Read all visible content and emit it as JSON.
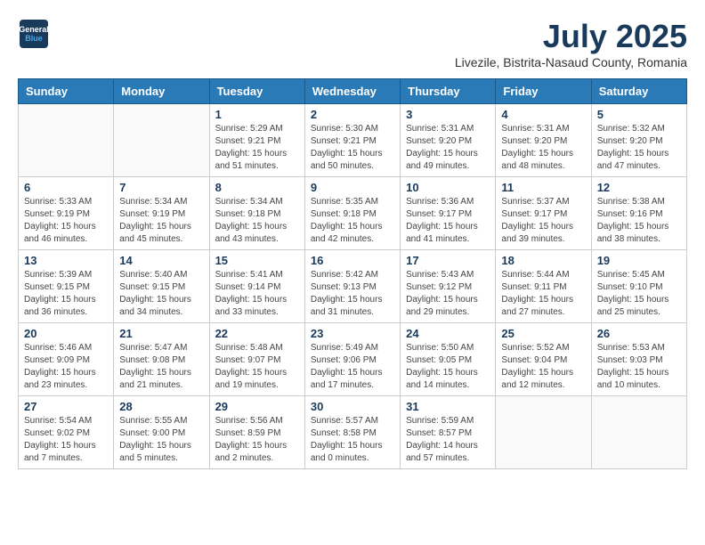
{
  "header": {
    "logo_line1": "General",
    "logo_line2": "Blue",
    "month_title": "July 2025",
    "subtitle": "Livezile, Bistrita-Nasaud County, Romania"
  },
  "weekdays": [
    "Sunday",
    "Monday",
    "Tuesday",
    "Wednesday",
    "Thursday",
    "Friday",
    "Saturday"
  ],
  "weeks": [
    [
      {
        "day": "",
        "info": ""
      },
      {
        "day": "",
        "info": ""
      },
      {
        "day": "1",
        "info": "Sunrise: 5:29 AM\nSunset: 9:21 PM\nDaylight: 15 hours and 51 minutes."
      },
      {
        "day": "2",
        "info": "Sunrise: 5:30 AM\nSunset: 9:21 PM\nDaylight: 15 hours and 50 minutes."
      },
      {
        "day": "3",
        "info": "Sunrise: 5:31 AM\nSunset: 9:20 PM\nDaylight: 15 hours and 49 minutes."
      },
      {
        "day": "4",
        "info": "Sunrise: 5:31 AM\nSunset: 9:20 PM\nDaylight: 15 hours and 48 minutes."
      },
      {
        "day": "5",
        "info": "Sunrise: 5:32 AM\nSunset: 9:20 PM\nDaylight: 15 hours and 47 minutes."
      }
    ],
    [
      {
        "day": "6",
        "info": "Sunrise: 5:33 AM\nSunset: 9:19 PM\nDaylight: 15 hours and 46 minutes."
      },
      {
        "day": "7",
        "info": "Sunrise: 5:34 AM\nSunset: 9:19 PM\nDaylight: 15 hours and 45 minutes."
      },
      {
        "day": "8",
        "info": "Sunrise: 5:34 AM\nSunset: 9:18 PM\nDaylight: 15 hours and 43 minutes."
      },
      {
        "day": "9",
        "info": "Sunrise: 5:35 AM\nSunset: 9:18 PM\nDaylight: 15 hours and 42 minutes."
      },
      {
        "day": "10",
        "info": "Sunrise: 5:36 AM\nSunset: 9:17 PM\nDaylight: 15 hours and 41 minutes."
      },
      {
        "day": "11",
        "info": "Sunrise: 5:37 AM\nSunset: 9:17 PM\nDaylight: 15 hours and 39 minutes."
      },
      {
        "day": "12",
        "info": "Sunrise: 5:38 AM\nSunset: 9:16 PM\nDaylight: 15 hours and 38 minutes."
      }
    ],
    [
      {
        "day": "13",
        "info": "Sunrise: 5:39 AM\nSunset: 9:15 PM\nDaylight: 15 hours and 36 minutes."
      },
      {
        "day": "14",
        "info": "Sunrise: 5:40 AM\nSunset: 9:15 PM\nDaylight: 15 hours and 34 minutes."
      },
      {
        "day": "15",
        "info": "Sunrise: 5:41 AM\nSunset: 9:14 PM\nDaylight: 15 hours and 33 minutes."
      },
      {
        "day": "16",
        "info": "Sunrise: 5:42 AM\nSunset: 9:13 PM\nDaylight: 15 hours and 31 minutes."
      },
      {
        "day": "17",
        "info": "Sunrise: 5:43 AM\nSunset: 9:12 PM\nDaylight: 15 hours and 29 minutes."
      },
      {
        "day": "18",
        "info": "Sunrise: 5:44 AM\nSunset: 9:11 PM\nDaylight: 15 hours and 27 minutes."
      },
      {
        "day": "19",
        "info": "Sunrise: 5:45 AM\nSunset: 9:10 PM\nDaylight: 15 hours and 25 minutes."
      }
    ],
    [
      {
        "day": "20",
        "info": "Sunrise: 5:46 AM\nSunset: 9:09 PM\nDaylight: 15 hours and 23 minutes."
      },
      {
        "day": "21",
        "info": "Sunrise: 5:47 AM\nSunset: 9:08 PM\nDaylight: 15 hours and 21 minutes."
      },
      {
        "day": "22",
        "info": "Sunrise: 5:48 AM\nSunset: 9:07 PM\nDaylight: 15 hours and 19 minutes."
      },
      {
        "day": "23",
        "info": "Sunrise: 5:49 AM\nSunset: 9:06 PM\nDaylight: 15 hours and 17 minutes."
      },
      {
        "day": "24",
        "info": "Sunrise: 5:50 AM\nSunset: 9:05 PM\nDaylight: 15 hours and 14 minutes."
      },
      {
        "day": "25",
        "info": "Sunrise: 5:52 AM\nSunset: 9:04 PM\nDaylight: 15 hours and 12 minutes."
      },
      {
        "day": "26",
        "info": "Sunrise: 5:53 AM\nSunset: 9:03 PM\nDaylight: 15 hours and 10 minutes."
      }
    ],
    [
      {
        "day": "27",
        "info": "Sunrise: 5:54 AM\nSunset: 9:02 PM\nDaylight: 15 hours and 7 minutes."
      },
      {
        "day": "28",
        "info": "Sunrise: 5:55 AM\nSunset: 9:00 PM\nDaylight: 15 hours and 5 minutes."
      },
      {
        "day": "29",
        "info": "Sunrise: 5:56 AM\nSunset: 8:59 PM\nDaylight: 15 hours and 2 minutes."
      },
      {
        "day": "30",
        "info": "Sunrise: 5:57 AM\nSunset: 8:58 PM\nDaylight: 15 hours and 0 minutes."
      },
      {
        "day": "31",
        "info": "Sunrise: 5:59 AM\nSunset: 8:57 PM\nDaylight: 14 hours and 57 minutes."
      },
      {
        "day": "",
        "info": ""
      },
      {
        "day": "",
        "info": ""
      }
    ]
  ]
}
